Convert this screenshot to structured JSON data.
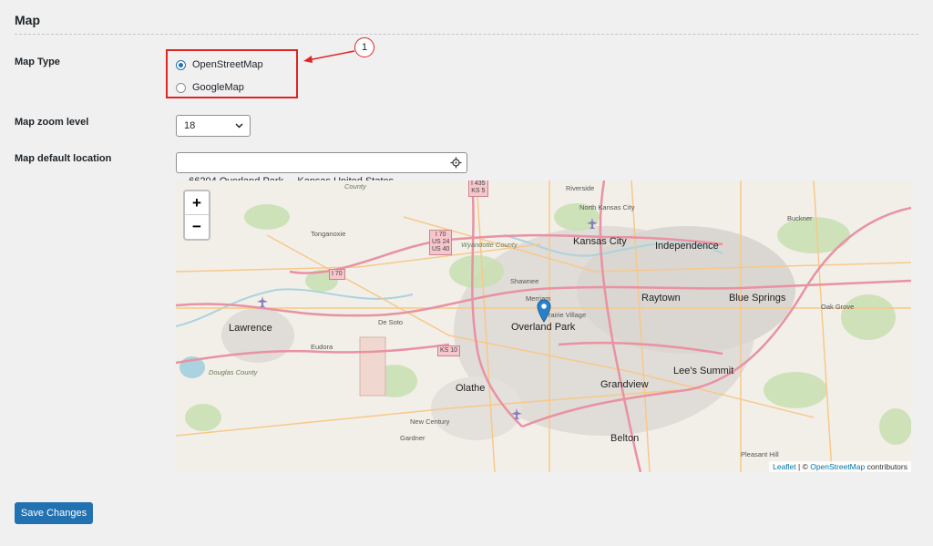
{
  "section": {
    "title": "Map"
  },
  "map_type": {
    "label": "Map Type",
    "options": [
      {
        "label": "OpenStreetMap",
        "checked": true
      },
      {
        "label": "GoogleMap",
        "checked": false
      }
    ],
    "callout_number": "1"
  },
  "zoom_level": {
    "label": "Map zoom level",
    "value": "18"
  },
  "default_location": {
    "label": "Map default location",
    "value": "66204 Overland Park   , Kansas United States"
  },
  "map": {
    "zoom_in": "+",
    "zoom_out": "−",
    "attribution": {
      "leaflet": "Leaflet",
      "sep": " | © ",
      "osm": "OpenStreetMap",
      "suffix": " contributors"
    },
    "places": {
      "kansas_city": "Kansas City",
      "independence": "Independence",
      "raytown": "Raytown",
      "blue_springs": "Blue Springs",
      "overland_park": "Overland Park",
      "olathe": "Olathe",
      "grandview": "Grandview",
      "lees_summit": "Lee's Summit",
      "belton": "Belton",
      "lawrence": "Lawrence",
      "tonganoxie": "Tonganoxie",
      "shawnee": "Shawnee",
      "merriam": "Merriam",
      "prairie_village": "Prairie Village",
      "de_soto": "De Soto",
      "eudora": "Eudora",
      "new_century": "New Century",
      "gardner": "Gardner",
      "oak_grove": "Oak Grove",
      "buckner": "Buckner",
      "pleasant_hill": "Pleasant Hill",
      "riverside": "Riverside",
      "north_kansas_city": "North Kansas City",
      "county": "County",
      "wyandotte_county": "Wyandotte County",
      "douglas_county": "Douglas County"
    },
    "shields": {
      "i435": "I 435\nKS 5",
      "i70_cluster": "I 70\nUS 24\nUS 40",
      "i70": "I 70",
      "ks10": "KS 10"
    }
  },
  "buttons": {
    "save": "Save Changes"
  },
  "colors": {
    "accent": "#2271b1",
    "callout": "#e02424",
    "motorway": "#e892a2",
    "primary_road": "#fcd6a4",
    "marker": "#2a81cb"
  }
}
